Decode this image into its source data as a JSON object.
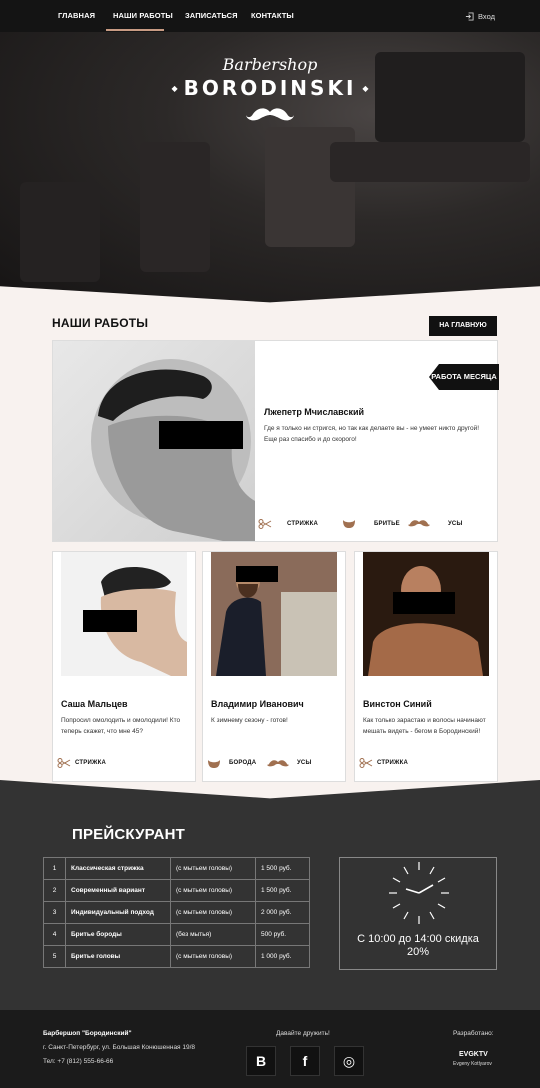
{
  "nav": {
    "items": [
      {
        "label": "ГЛАВНАЯ"
      },
      {
        "label": "НАШИ РАБОТЫ"
      },
      {
        "label": "ЗАПИСАТЬСЯ"
      },
      {
        "label": "КОНТАКТЫ"
      }
    ],
    "login": "Вход"
  },
  "hero": {
    "logo_script": "Barbershop",
    "logo_main": "BORODINSKI"
  },
  "works": {
    "title": "НАШИ РАБОТЫ",
    "home_button": "НА ГЛАВНУЮ",
    "featured": {
      "badge": "РАБОТА МЕСЯЦА",
      "name": "Лжепетр Мчиславский",
      "text": "Где я только ни стригся, но так как делаете вы - не умеет никто другой! Еще раз спасибо и до скорого!",
      "tags": [
        "СТРИЖКА",
        "БРИТЬЕ",
        "УСЫ"
      ]
    },
    "cards": [
      {
        "name": "Саша Мальцев",
        "text": "Попросил омолодить и омолодили! Кто теперь скажет, что мне 45?",
        "tags": [
          "СТРИЖКА"
        ]
      },
      {
        "name": "Владимир Иванович",
        "text": "К зимнему сезону - готов!",
        "tags": [
          "БОРОДА",
          "УСЫ"
        ]
      },
      {
        "name": "Винстон Синий",
        "text": "Как только зарастаю и волосы начинают мешать видеть - бегом в Бородинский!",
        "tags": [
          "СТРИЖКА"
        ]
      }
    ]
  },
  "pricing": {
    "title": "ПРЕЙСКУРАНТ",
    "rows": [
      {
        "n": "1",
        "service": "Классическая стрижка",
        "note": "(с мытьем головы)",
        "price": "1 500 руб."
      },
      {
        "n": "2",
        "service": "Современный вариант",
        "note": "(с мытьем головы)",
        "price": "1 500 руб."
      },
      {
        "n": "3",
        "service": "Индивидуальный подход",
        "note": "(с мытьем головы)",
        "price": "2 000 руб."
      },
      {
        "n": "4",
        "service": "Бритье бороды",
        "note": "(без мытья)",
        "price": "500 руб."
      },
      {
        "n": "5",
        "service": "Бритье головы",
        "note": "(с мытьем головы)",
        "price": "1 000 руб."
      }
    ],
    "discount_line1": "С 10:00 до 14:00 скидка",
    "discount_line2": "20%"
  },
  "footer": {
    "company": "Барбершоп \"Бородинский\"",
    "address": "г. Санкт-Петербург, ул. Большая Конюшенная 19/8",
    "phone": "Тел: +7 (812) 555-66-66",
    "friends": "Давайте дружить!",
    "social": [
      "В",
      "f",
      "◎"
    ],
    "developed": "Разработано:",
    "dev_logo": "EVGKTV",
    "dev_name": "Evgeny Kotlyarov"
  },
  "colors": {
    "accent": "#c89b83",
    "dark": "#141414",
    "panel": "#333333",
    "light": "#f8f2ef"
  }
}
